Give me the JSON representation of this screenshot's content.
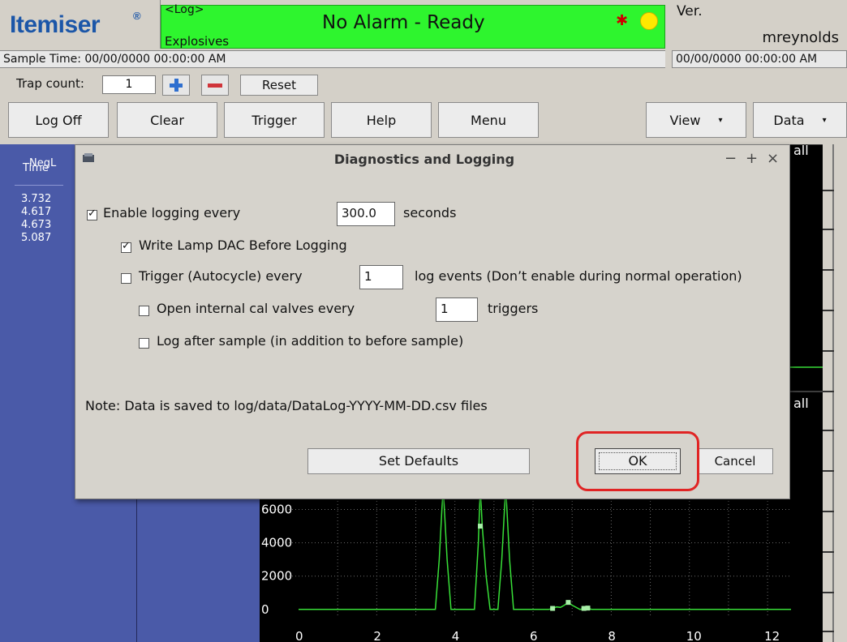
{
  "header": {
    "brand": "Itemiser",
    "brand_mark": "®",
    "mode": "<Log>",
    "detection": "Explosives",
    "status_message": "No Alarm - Ready",
    "status_color": "#2ef52e",
    "alarm_icon": "asterisk-icon",
    "light_icon": "yellow-circle-icon",
    "version_label": "Ver.",
    "user": "mreynolds",
    "sample_time": "Sample Time: 00/00/0000  00:00:00 AM",
    "clock": "00/00/0000  00:00:00 AM"
  },
  "trap": {
    "label": "Trap count:",
    "value": "1",
    "reset_label": "Reset"
  },
  "toolbar": {
    "log_off": "Log Off",
    "clear": "Clear",
    "trigger": "Trigger",
    "help": "Help",
    "menu": "Menu",
    "view": "View",
    "data": "Data"
  },
  "left_panel": {
    "column_head_1": "NegL",
    "column_head_2": "Time",
    "times": [
      "3.732",
      "4.617",
      "4.673",
      "5.087"
    ]
  },
  "side_labels": {
    "upper": "all",
    "lower": "all"
  },
  "chart": {
    "y_ticks": [
      "6000",
      "4000",
      "2000",
      "0"
    ],
    "x_ticks": [
      "0",
      "2",
      "4",
      "6",
      "8",
      "10",
      "12"
    ]
  },
  "chart_data": {
    "type": "line",
    "title": "",
    "xlabel": "",
    "ylabel": "",
    "xlim": [
      0,
      12.6
    ],
    "ylim": [
      -400,
      7000
    ],
    "x": [
      0,
      3.5,
      3.6,
      3.7,
      3.8,
      3.9,
      4.5,
      4.6,
      4.65,
      4.7,
      4.8,
      4.9,
      5.1,
      5.2,
      5.3,
      5.4,
      5.5,
      6.4,
      6.5,
      6.6,
      6.7,
      6.8,
      6.9,
      7.0,
      7.2,
      7.3,
      7.4,
      7.5,
      12.6
    ],
    "values": [
      0,
      0,
      3000,
      7400,
      3000,
      0,
      0,
      4000,
      7400,
      5000,
      2000,
      0,
      0,
      3000,
      7400,
      3000,
      0,
      0,
      60,
      150,
      120,
      250,
      420,
      250,
      0,
      60,
      80,
      0,
      0
    ],
    "series_color": "#38e038",
    "grid": true
  },
  "dialog": {
    "title": "Diagnostics and Logging",
    "minimize": "−",
    "maximize": "+",
    "close": "×",
    "enable_logging_label": "Enable logging every",
    "enable_logging_value": "300.0",
    "enable_logging_unit": "seconds",
    "write_lamp_label": "Write Lamp DAC Before Logging",
    "trigger_label": "Trigger (Autocycle) every",
    "trigger_value": "1",
    "trigger_unit": "log events (Don’t enable during normal operation)",
    "cal_valves_label": "Open internal cal valves every",
    "cal_valves_value": "1",
    "cal_valves_unit": "triggers",
    "log_after_label": "Log after sample (in addition to before sample)",
    "note": "Note: Data is saved to log/data/DataLog-YYYY-MM-DD.csv files",
    "set_defaults": "Set Defaults",
    "ok": "OK",
    "cancel": "Cancel",
    "checkboxes": {
      "enable_logging": true,
      "write_lamp": true,
      "trigger": false,
      "cal_valves": false,
      "log_after": false
    }
  },
  "annotation": {
    "highlight_color": "#e02424"
  }
}
